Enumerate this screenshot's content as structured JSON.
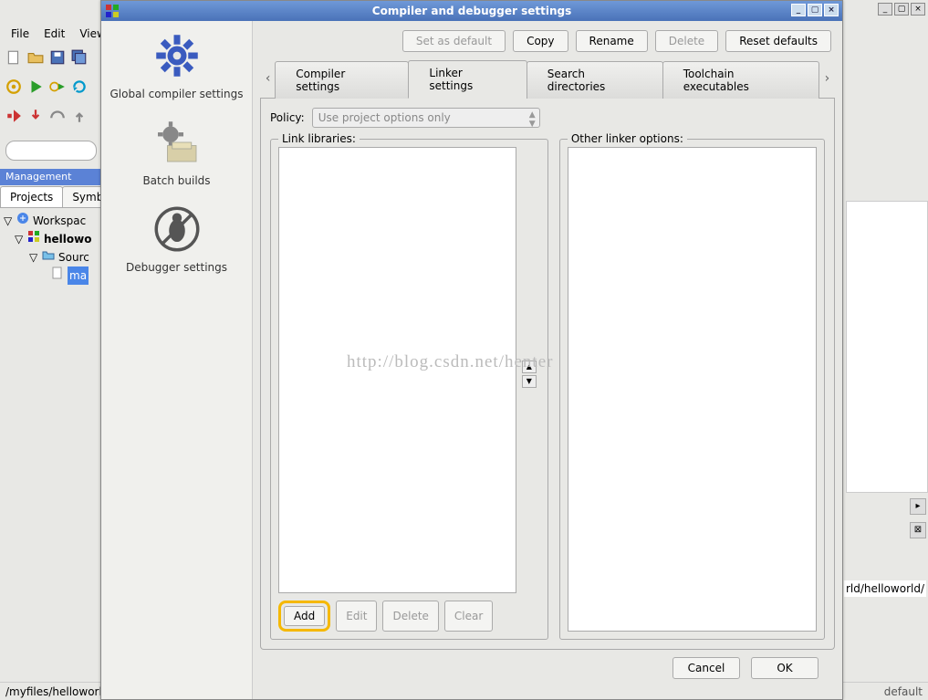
{
  "main_window_controls": {
    "min": "_",
    "max": "▢",
    "close": "×"
  },
  "menubar": [
    "File",
    "Edit",
    "View"
  ],
  "management": {
    "title": "Management"
  },
  "mgmt_tabs": {
    "projects": "Projects",
    "symbols": "Symb"
  },
  "tree": {
    "workspace": "Workspac",
    "project": "hellowo",
    "sources": "Sourc",
    "file": "ma"
  },
  "dialog": {
    "title": "Compiler and debugger settings",
    "top_buttons": {
      "set_default": "Set as default",
      "copy": "Copy",
      "rename": "Rename",
      "delete": "Delete",
      "reset": "Reset defaults"
    },
    "sidebar": {
      "global": "Global compiler settings",
      "batch": "Batch builds",
      "debugger": "Debugger settings"
    },
    "tabs": {
      "compiler": "Compiler settings",
      "linker": "Linker settings",
      "search": "Search directories",
      "toolchain": "Toolchain executables"
    },
    "policy_label": "Policy:",
    "policy_value": "Use project options only",
    "link_libraries_label": "Link libraries:",
    "other_options_label": "Other linker options:",
    "list_buttons": {
      "add": "Add",
      "edit": "Edit",
      "delete": "Delete",
      "clear": "Clear"
    },
    "footer": {
      "cancel": "Cancel",
      "ok": "OK"
    }
  },
  "watermark": "http://blog.csdn.net/henter",
  "statusbar": {
    "left": "/myfiles/helloworld",
    "right_frag": "rld/helloworld/",
    "default": "default"
  }
}
